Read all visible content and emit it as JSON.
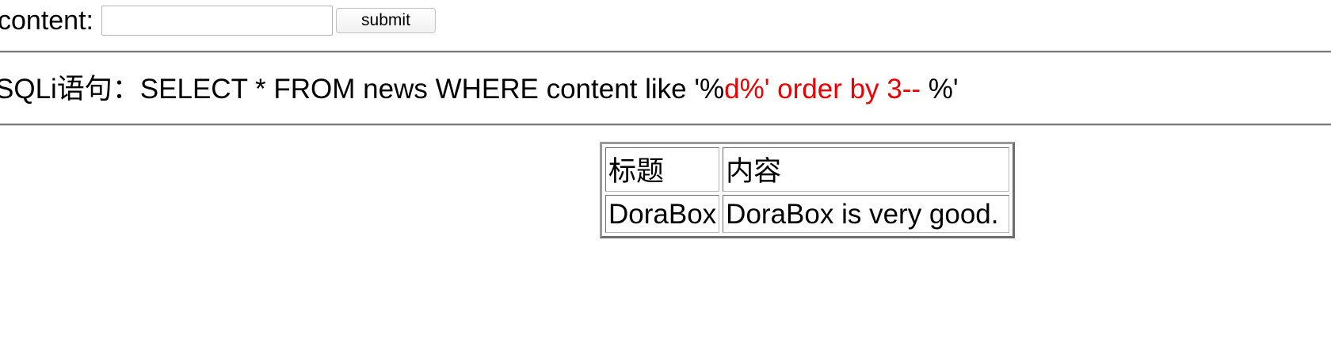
{
  "form": {
    "label": "content:",
    "input_value": "",
    "submit_label": "submit"
  },
  "sql": {
    "prefix": "SQLi语句：SELECT * FROM news WHERE content like '%",
    "injected": "d%' order by 3--",
    "suffix": " %'",
    "injected_color": "#ee0000"
  },
  "table": {
    "headers": [
      "标题",
      "内容"
    ],
    "rows": [
      [
        "DoraBox",
        "DoraBox is very good."
      ]
    ]
  }
}
